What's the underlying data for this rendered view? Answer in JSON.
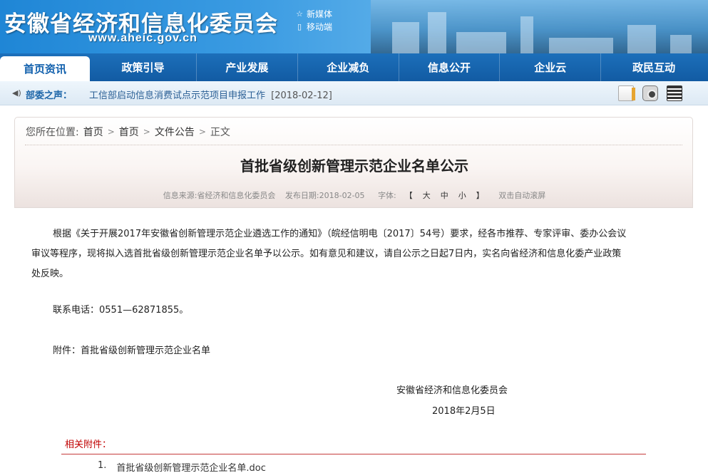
{
  "header": {
    "site_title": "安徽省经济和信息化委员会",
    "site_url": "www.aheic.gov.cn",
    "quick_links": [
      {
        "icon": "star-icon",
        "label": "新媒体"
      },
      {
        "icon": "mobile-icon",
        "label": "移动端"
      }
    ]
  },
  "nav": {
    "items": [
      "首页资讯",
      "政策引导",
      "产业发展",
      "企业减负",
      "信息公开",
      "企业云",
      "政民互动"
    ],
    "active_index": 0
  },
  "notice": {
    "label": "部委之声：",
    "text": "工信部启动信息消费试点示范项目申报工作",
    "date": "[2018-02-12]",
    "tools": [
      "document-icon",
      "camera-icon",
      "film-icon"
    ]
  },
  "breadcrumb": {
    "prefix": "您所在位置:",
    "items": [
      "首页",
      "首页",
      "文件公告",
      "正文"
    ]
  },
  "article": {
    "title": "首批省级创新管理示范企业名单公示",
    "meta_source": "信息来源:省经济和信息化委员会",
    "meta_date": "发布日期:2018-02-05",
    "meta_font_label": "字体:",
    "font_bracket_open": "【",
    "font_sizes": [
      "大",
      "中",
      "小"
    ],
    "font_bracket_close": "】",
    "meta_autoscroll": "双击自动滚屏",
    "body_lines": [
      "根据《关于开展2017年安徽省创新管理示范企业遴选工作的通知》（皖经信明电〔2017〕54号）要求，经各市推荐、专家评审、委办公会议",
      "审议等程序，现将拟入选首批省级创新管理示范企业名单予以公示。如有意见和建议，请自公示之日起7日内，实名向省经济和信息化委产业政策",
      "处反映。"
    ],
    "contact": "联系电话：0551—62871855。",
    "attachment_line": "附件：首批省级创新管理示范企业名单",
    "sign_org": "安徽省经济和信息化委员会",
    "sign_date": "2018年2月5日"
  },
  "related": {
    "heading": "相关附件：",
    "files": [
      {
        "index": "1.",
        "name": "首批省级创新管理示范企业名单.doc"
      }
    ]
  },
  "colors": {
    "nav_blue": "#125ba3",
    "banner_blue": "#1f86d6",
    "accent_red": "#c00000",
    "notice_label": "#1c65a8"
  }
}
